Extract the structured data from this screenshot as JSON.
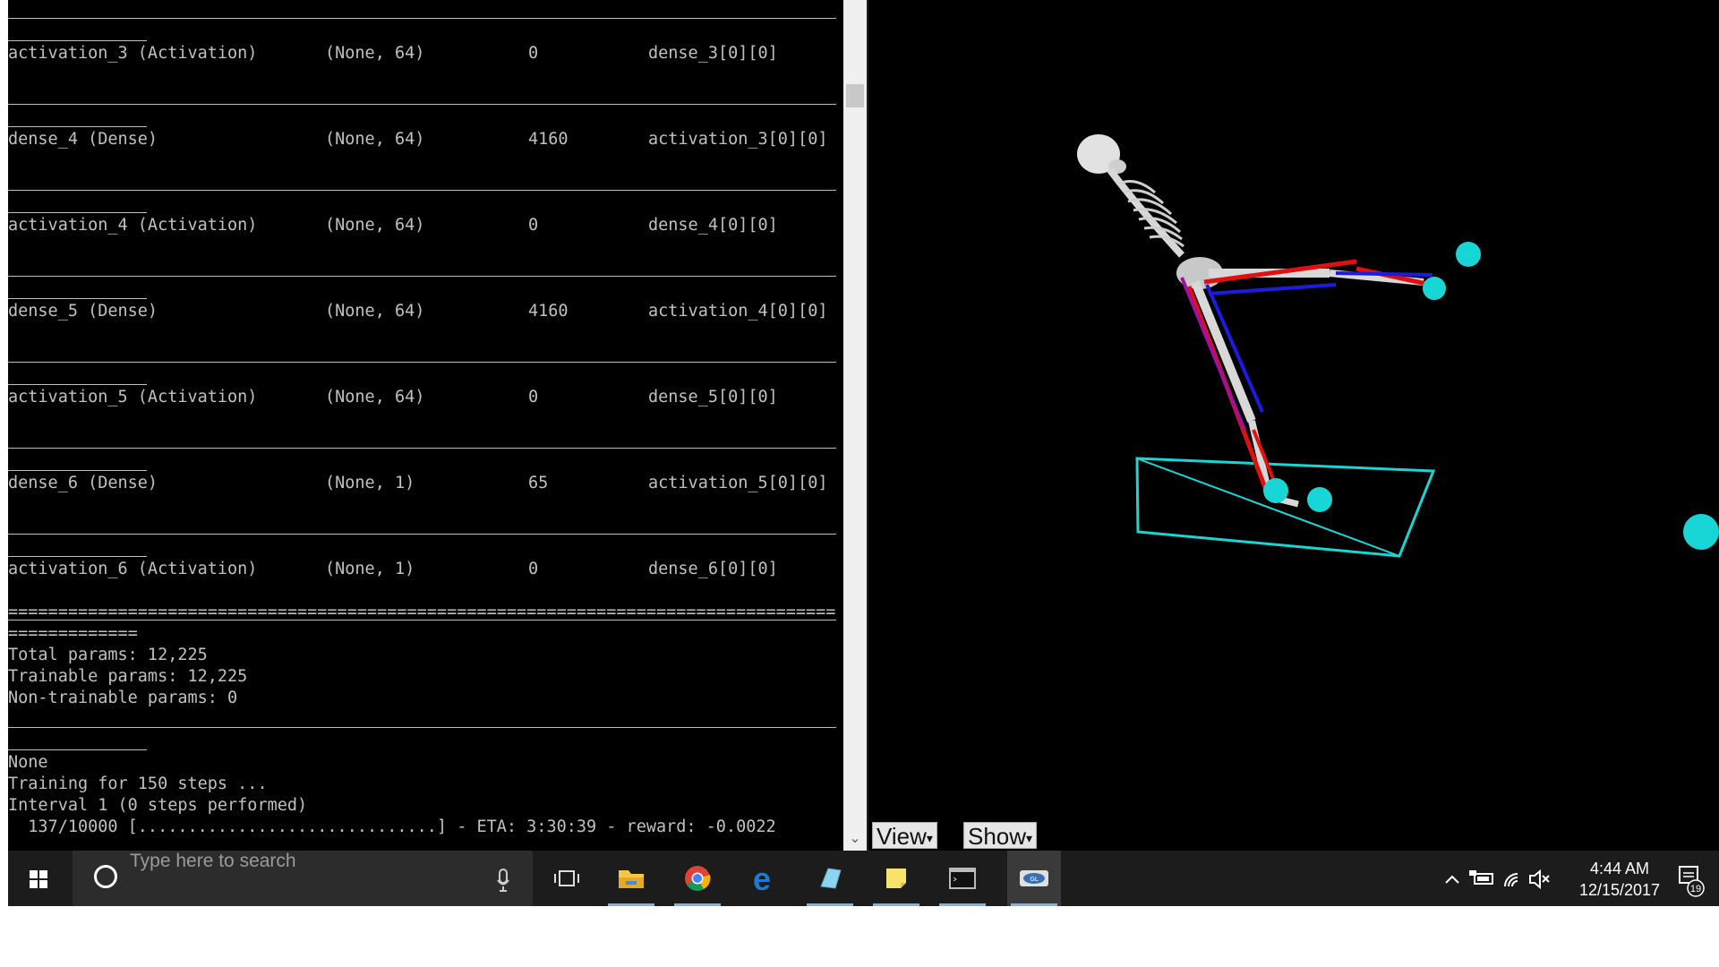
{
  "console": {
    "layers": [
      {
        "name": "activation_3 (Activation)",
        "shape": "(None, 64)",
        "params": "0",
        "connected": "dense_3[0][0]"
      },
      {
        "name": "dense_4 (Dense)",
        "shape": "(None, 64)",
        "params": "4160",
        "connected": "activation_3[0][0]"
      },
      {
        "name": "activation_4 (Activation)",
        "shape": "(None, 64)",
        "params": "0",
        "connected": "dense_4[0][0]"
      },
      {
        "name": "dense_5 (Dense)",
        "shape": "(None, 64)",
        "params": "4160",
        "connected": "activation_4[0][0]"
      },
      {
        "name": "activation_5 (Activation)",
        "shape": "(None, 64)",
        "params": "0",
        "connected": "dense_5[0][0]"
      },
      {
        "name": "dense_6 (Dense)",
        "shape": "(None, 1)",
        "params": "65",
        "connected": "activation_5[0][0]"
      },
      {
        "name": "activation_6 (Activation)",
        "shape": "(None, 1)",
        "params": "0",
        "connected": "dense_6[0][0]"
      }
    ],
    "double_rule": "===================================================================================",
    "double_rule_tail": "=============",
    "total_params": "Total params: 12,225",
    "trainable_params": "Trainable params: 12,225",
    "non_trainable_params": "Non-trainable params: 0",
    "none_line": "None",
    "training_line": "Training for 150 steps ...",
    "interval_line": "Interval 1 (0 steps performed)",
    "progress_line": "  137/10000 [..............................] - ETA: 3:30:39 - reward: -0.0022"
  },
  "viewer": {
    "view_button": "View",
    "show_button": "Show",
    "colors": {
      "markers": "#19d6d6",
      "muscle_red": "#e01010",
      "muscle_blue": "#1c1ce0",
      "bone": "#d8d8d8"
    }
  },
  "taskbar": {
    "search_placeholder": "Type here to search",
    "apps": [
      "task-view",
      "file-explorer",
      "chrome",
      "edge",
      "paint",
      "sticky-notes",
      "command-prompt",
      "opengl-app"
    ],
    "time": "4:44 AM",
    "date": "12/15/2017",
    "notification_count": "19"
  }
}
